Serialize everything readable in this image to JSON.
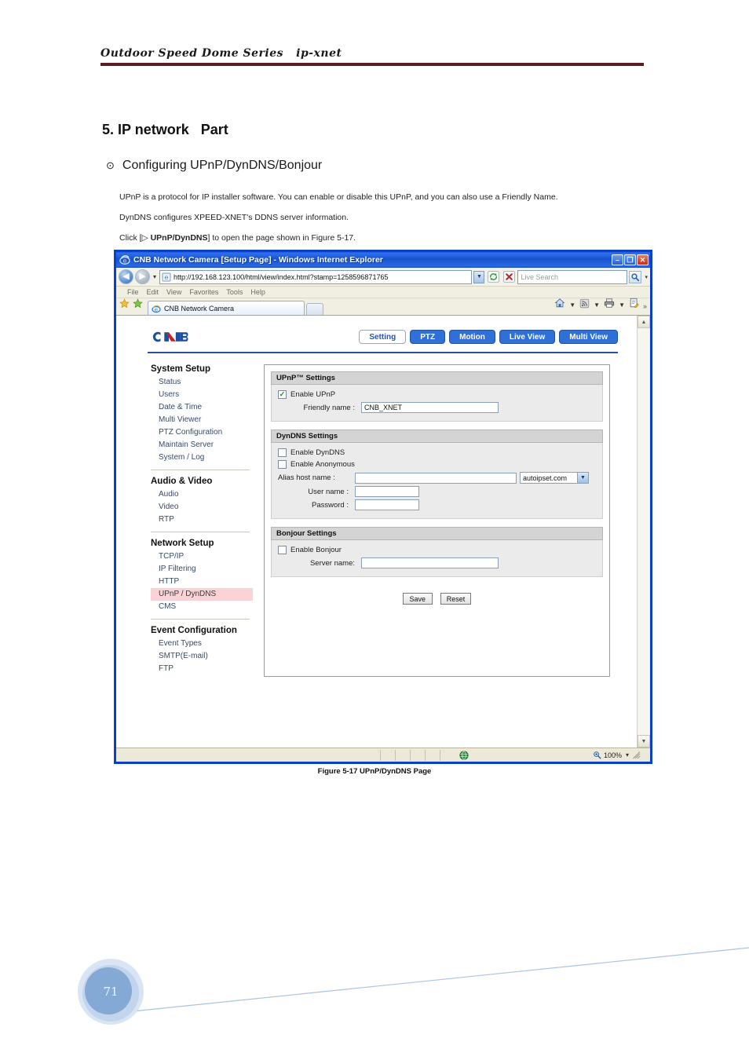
{
  "document": {
    "header_title": "Outdoor Speed Dome Series   ip-xnet",
    "header_rule_color": "#5b1d22",
    "section_title": "5. IP network   Part",
    "subsection_bullet": "⊙",
    "subsection_title": "Configuring UPnP/DynDNS/Bonjour",
    "paragraph_1": "UPnP is a protocol for IP installer software. You can enable or disable this UPnP, and you can also use a Friendly Name.",
    "paragraph_2": "DynDNS configures XPEED-XNET's DDNS server information.",
    "paragraph_3_pre": "Click [▷ ",
    "paragraph_3_bold": "UPnP/DynDNS",
    "paragraph_3_post": "] to open the page shown in Figure 5-17.",
    "figure_caption": "Figure 5-17   UPnP/DynDNS Page",
    "page_number": "71"
  },
  "browser": {
    "title": "CNB Network Camera [Setup Page] - Windows Internet Explorer",
    "title_icon": "ie-logo-icon",
    "minimize_label": "–",
    "maximize_label": "❐",
    "close_label": "✕",
    "back_icon": "back-arrow-icon",
    "forward_icon": "forward-arrow-icon",
    "history_caret": "▾",
    "address_icon": "ie-page-icon",
    "address_value": "http://192.168.123.100/html/view/index.html?stamp=1258596871765",
    "address_dropdown_icon": "chevron-down-icon",
    "refresh_icon": "refresh-icon",
    "stop_icon": "stop-icon",
    "search_placeholder": "Live Search",
    "search_go_icon": "magnifier-icon",
    "search_caret": "▾",
    "menu_items": [
      "File",
      "Edit",
      "View",
      "Favorites",
      "Tools",
      "Help"
    ],
    "fav_star_icon": "favorites-star-icon",
    "add_fav_icon": "add-favorite-icon",
    "tab_label": "CNB Network Camera",
    "tab_icon": "ie-page-icon",
    "toolbar_icons": [
      "home-icon",
      "rss-feed-icon",
      "print-icon",
      "page-tools-icon"
    ],
    "toolbar_overflow": "»",
    "scroll_up_icon": "▲",
    "scroll_down_icon": "▼",
    "status_zone_icon": "globe-icon",
    "status_zone_label": "",
    "status_zoom_icon": "zoom-icon",
    "status_zoom_label": "100%",
    "status_zoom_caret": "▾"
  },
  "camera_ui": {
    "logo": "cnb-logo",
    "nav_buttons": [
      {
        "label": "Setting",
        "active": true
      },
      {
        "label": "PTZ",
        "active": false
      },
      {
        "label": "Motion",
        "active": false
      },
      {
        "label": "Live View",
        "active": false
      },
      {
        "label": "Multi View",
        "active": false
      }
    ],
    "sidebar": [
      {
        "title": "System Setup",
        "links": [
          {
            "label": "Status",
            "selected": false
          },
          {
            "label": "Users",
            "selected": false
          },
          {
            "label": "Date & Time",
            "selected": false
          },
          {
            "label": "Multi Viewer",
            "selected": false
          },
          {
            "label": "PTZ Configuration",
            "selected": false
          },
          {
            "label": "Maintain Server",
            "selected": false
          },
          {
            "label": "System / Log",
            "selected": false
          }
        ]
      },
      {
        "title": "Audio & Video",
        "links": [
          {
            "label": "Audio",
            "selected": false
          },
          {
            "label": "Video",
            "selected": false
          },
          {
            "label": "RTP",
            "selected": false
          }
        ]
      },
      {
        "title": "Network Setup",
        "links": [
          {
            "label": "TCP/IP",
            "selected": false
          },
          {
            "label": "IP Filtering",
            "selected": false
          },
          {
            "label": "HTTP",
            "selected": false
          },
          {
            "label": "UPnP / DynDNS",
            "selected": true
          },
          {
            "label": "CMS",
            "selected": false
          }
        ]
      },
      {
        "title": "Event Configuration",
        "links": [
          {
            "label": "Event Types",
            "selected": false
          },
          {
            "label": "SMTP(E-mail)",
            "selected": false
          },
          {
            "label": "FTP",
            "selected": false
          }
        ]
      }
    ],
    "upnp": {
      "title": "UPnP™ Settings",
      "enable_label": "Enable UPnP",
      "enable_checked": true,
      "friendly_name_label": "Friendly name :",
      "friendly_name_value": "CNB_XNET"
    },
    "dyndns": {
      "title": "DynDNS Settings",
      "enable_label": "Enable DynDNS",
      "enable_checked": false,
      "anonymous_label": "Enable Anonymous",
      "anonymous_checked": false,
      "alias_label": "Alias host name :",
      "alias_value": "",
      "provider_value": "autoipset.com",
      "username_label": "User name :",
      "username_value": "",
      "password_label": "Password :",
      "password_value": ""
    },
    "bonjour": {
      "title": "Bonjour Settings",
      "enable_label": "Enable Bonjour",
      "enable_checked": false,
      "server_name_label": "Server name:",
      "server_name_value": ""
    },
    "buttons": {
      "save_label": "Save",
      "reset_label": "Reset"
    },
    "colors": {
      "nav_blue": "#2e6fd8",
      "rule_blue": "#2b4fa0",
      "selected_pink": "#fbd2d6",
      "panel_grey": "#ebebeb",
      "panel_title_grey": "#d4d4d4"
    }
  }
}
